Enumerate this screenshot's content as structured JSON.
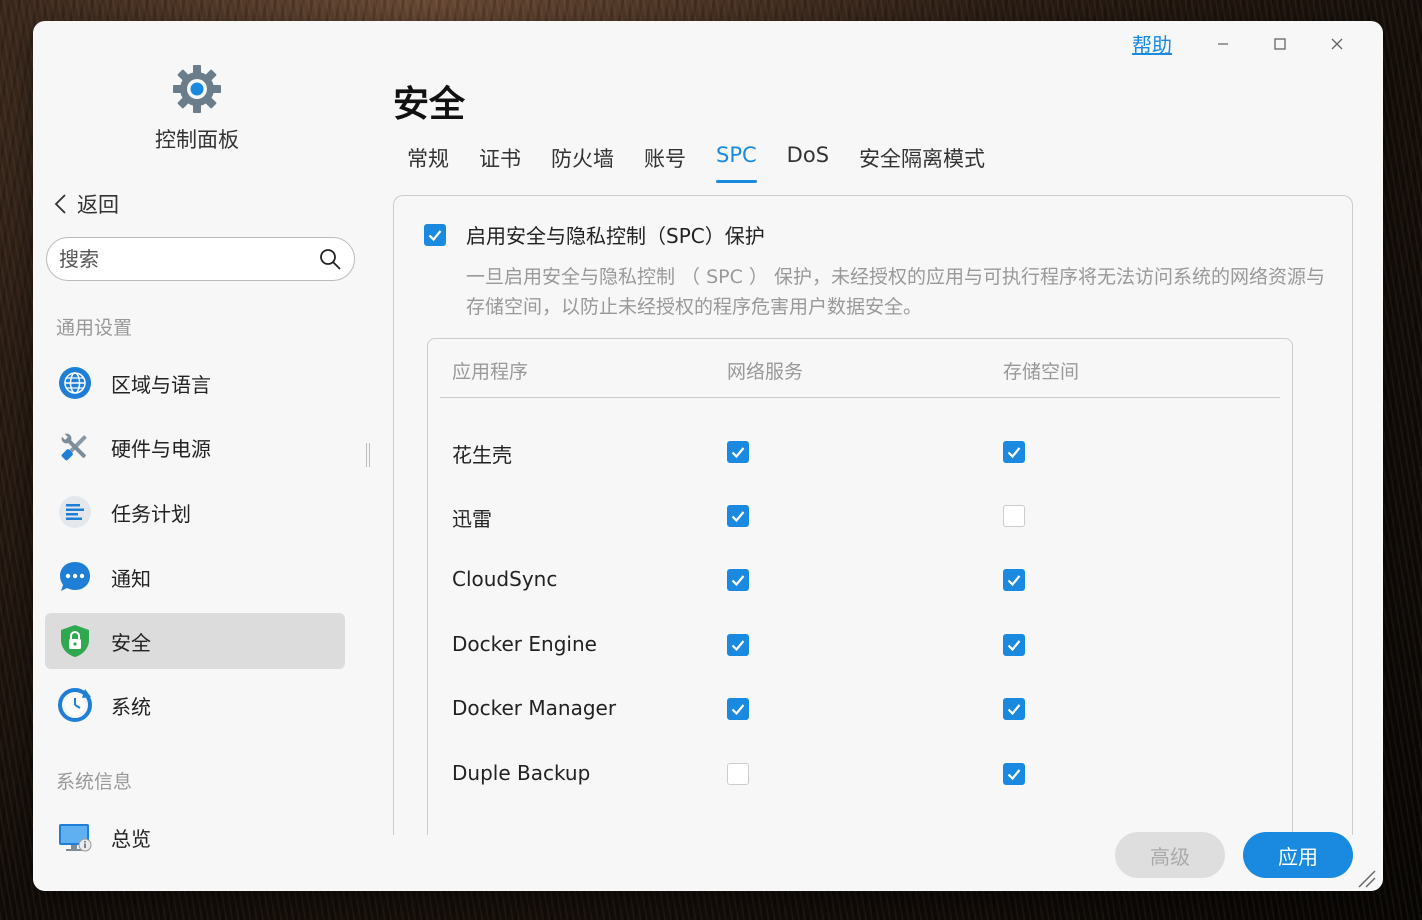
{
  "window": {
    "help_label": "帮助",
    "controls": [
      "minimize-icon",
      "maximize-icon",
      "close-icon"
    ]
  },
  "sidebar": {
    "app_title": "控制面板",
    "back_label": "返回",
    "search_placeholder": "搜索",
    "section_general": "通用设置",
    "section_sysinfo": "系统信息",
    "items": [
      {
        "label": "区域与语言",
        "icon": "globe-icon"
      },
      {
        "label": "硬件与电源",
        "icon": "tools-icon"
      },
      {
        "label": "任务计划",
        "icon": "task-list-icon"
      },
      {
        "label": "通知",
        "icon": "chat-bubble-icon"
      },
      {
        "label": "安全",
        "icon": "shield-lock-icon",
        "active": true
      },
      {
        "label": "系统",
        "icon": "system-clock-icon"
      }
    ],
    "sysinfo_items": [
      {
        "label": "总览",
        "icon": "monitor-info-icon"
      }
    ]
  },
  "main": {
    "title": "安全",
    "tabs": [
      {
        "label": "常规"
      },
      {
        "label": "证书"
      },
      {
        "label": "防火墙"
      },
      {
        "label": "账号"
      },
      {
        "label": "SPC",
        "active": true
      },
      {
        "label": "DoS"
      },
      {
        "label": "安全隔离模式"
      }
    ],
    "spc": {
      "enable_label": "启用安全与隐私控制（SPC）保护",
      "enabled": true,
      "description": "一旦启用安全与隐私控制 （ SPC ） 保护，未经授权的应用与可执行程序将无法访问系统的网络资源与存储空间，以防止未经授权的程序危害用户数据安全。",
      "columns": [
        "应用程序",
        "网络服务",
        "存储空间"
      ],
      "rows": [
        {
          "name": "花生壳",
          "network": true,
          "storage": true
        },
        {
          "name": "迅雷",
          "network": true,
          "storage": false
        },
        {
          "name": "CloudSync",
          "network": true,
          "storage": true
        },
        {
          "name": "Docker Engine",
          "network": true,
          "storage": true
        },
        {
          "name": "Docker Manager",
          "network": true,
          "storage": true
        },
        {
          "name": "Duple Backup",
          "network": false,
          "storage": true
        }
      ]
    }
  },
  "footer": {
    "advanced_label": "高级",
    "apply_label": "应用"
  },
  "colors": {
    "accent": "#1a8ae0",
    "active_nav_bg": "#dcdcdc",
    "disabled_btn_bg": "#dedede"
  }
}
